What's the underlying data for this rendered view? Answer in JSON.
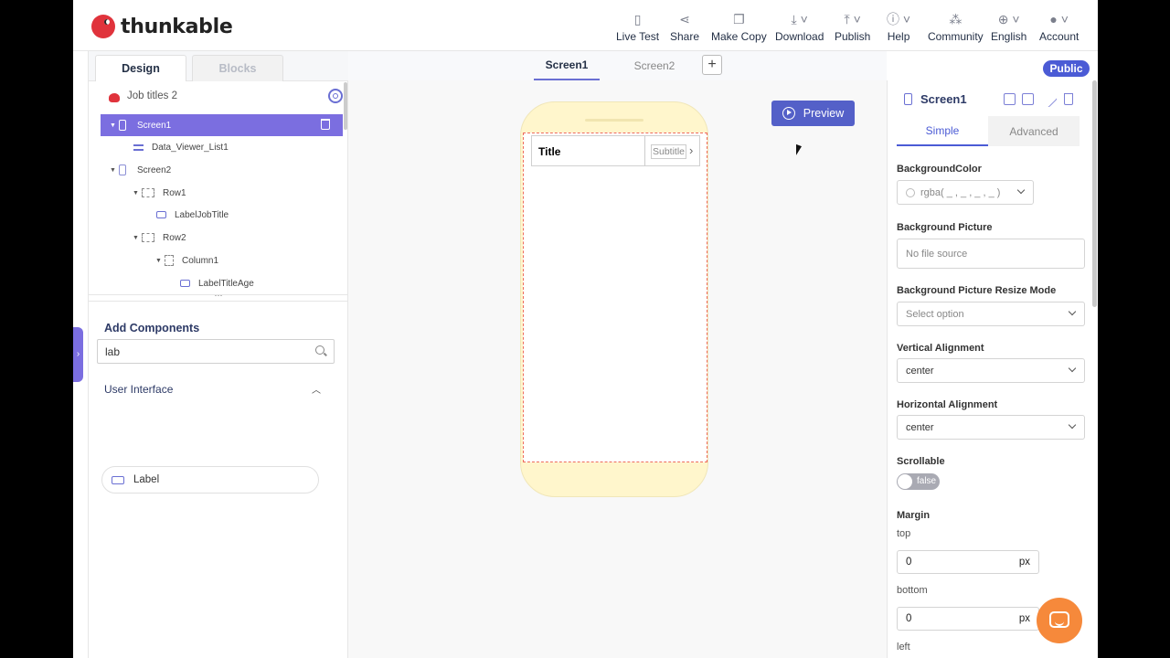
{
  "app": {
    "logo_text": "thunkable"
  },
  "nav": {
    "live_test": "Live Test",
    "share": "Share",
    "make_copy": "Make Copy",
    "download": "Download",
    "publish": "Publish",
    "help": "Help",
    "community": "Community",
    "english": "English",
    "account": "Account"
  },
  "left_tabs": {
    "design": "Design",
    "blocks": "Blocks"
  },
  "tree": {
    "project_name": "Job titles 2",
    "items": [
      {
        "label": "Screen1",
        "icon": "screen-icon",
        "selected": true
      },
      {
        "label": "Data_Viewer_List1",
        "icon": "list-icon"
      },
      {
        "label": "Screen2",
        "icon": "screen-icon"
      },
      {
        "label": "Row1",
        "icon": "row-icon"
      },
      {
        "label": "LabelJobTitle",
        "icon": "label-icon"
      },
      {
        "label": "Row2",
        "icon": "row-icon"
      },
      {
        "label": "Column1",
        "icon": "column-icon"
      },
      {
        "label": "LabelTitleAge",
        "icon": "label-icon"
      }
    ]
  },
  "components": {
    "title": "Add Components",
    "search_value": "lab",
    "section": "User Interface",
    "items": [
      {
        "label": "Label",
        "icon": "label-icon"
      }
    ]
  },
  "screen_tabs": {
    "tabs": [
      "Screen1",
      "Screen2"
    ],
    "active": "Screen1",
    "add": "+"
  },
  "canvas": {
    "preview_label": "Preview",
    "list_item": {
      "title": "Title",
      "subtitle": "Subtitle",
      "arrow": "›"
    }
  },
  "right_panel": {
    "badge": "Public",
    "header_title": "Screen1",
    "tabs": {
      "simple": "Simple",
      "advanced": "Advanced"
    },
    "props": {
      "background_color_label": "BackgroundColor",
      "background_color_value": "rgba( _ , _ , _ , _ )",
      "background_picture_label": "Background Picture",
      "background_picture_value": "No file source",
      "resize_mode_label": "Background Picture Resize Mode",
      "resize_mode_value": "Select option",
      "vertical_alignment_label": "Vertical Alignment",
      "vertical_alignment_value": "center",
      "horizontal_alignment_label": "Horizontal Alignment",
      "horizontal_alignment_value": "center",
      "scrollable_label": "Scrollable",
      "scrollable_value": "false",
      "margin_label": "Margin",
      "margin_top_label": "top",
      "margin_top_value": "0",
      "margin_bottom_label": "bottom",
      "margin_bottom_value": "0",
      "margin_left_label": "left",
      "unit": "px"
    }
  },
  "colors": {
    "accent": "#6a6fd3",
    "selected_row": "#7b6ee0",
    "preview_button": "#5460c8",
    "public_badge": "#4b5bd5",
    "phone_frame": "#fff6cc",
    "chat_button": "#f6893b"
  }
}
